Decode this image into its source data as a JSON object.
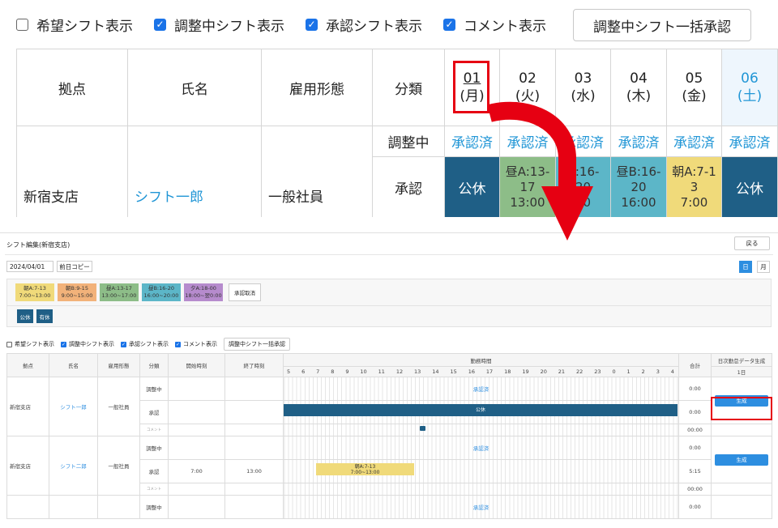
{
  "zoom": {
    "options": [
      {
        "label": "希望シフト表示",
        "checked": false
      },
      {
        "label": "調整中シフト表示",
        "checked": true
      },
      {
        "label": "承認シフト表示",
        "checked": true
      },
      {
        "label": "コメント表示",
        "checked": true
      }
    ],
    "bulk_approve_label": "調整中シフト一括承認",
    "headers": {
      "location": "拠点",
      "name": "氏名",
      "employment": "雇用形態",
      "category": "分類"
    },
    "days": [
      {
        "num": "01",
        "dow": "(月)"
      },
      {
        "num": "02",
        "dow": "(火)"
      },
      {
        "num": "03",
        "dow": "(水)"
      },
      {
        "num": "04",
        "dow": "(木)"
      },
      {
        "num": "05",
        "dow": "(金)"
      },
      {
        "num": "06",
        "dow": "(土)"
      }
    ],
    "row": {
      "location": "新宿支店",
      "name": "シフト一郎",
      "employment": "一般社員",
      "adjusting_label": "調整中",
      "approved_label": "承認",
      "adjusting_status": "承認済",
      "cells": [
        {
          "l1": "公休",
          "l2": "",
          "l3": ""
        },
        {
          "l1": "昼A:13-",
          "l2": "17",
          "l3": "13:00"
        },
        {
          "l1": "B:16-",
          "l2": "20",
          "l3": "00"
        },
        {
          "l1": "昼B:16-",
          "l2": "20",
          "l3": "16:00"
        },
        {
          "l1": "朝A:7-1",
          "l2": "3",
          "l3": "7:00"
        },
        {
          "l1": "公休",
          "l2": "",
          "l3": ""
        }
      ]
    }
  },
  "editor": {
    "title": "シフト編集(新宿支店)",
    "back_label": "戻る",
    "date_value": "2024/04/01",
    "copy_label": "前日コピー",
    "view_day": "日",
    "view_month": "月",
    "patterns": [
      {
        "name": "朝A:7-13",
        "time": "7:00~13:00",
        "color": "#f0da7a"
      },
      {
        "name": "朝B:9-15",
        "time": "9:00~15:00",
        "color": "#f2b27a"
      },
      {
        "name": "昼A:13-17",
        "time": "13:00~17:00",
        "color": "#8dbd88"
      },
      {
        "name": "昼B:16-20",
        "time": "16:00~20:00",
        "color": "#5cb6c8"
      },
      {
        "name": "夕A:18-00",
        "time": "18:00~翌0:00",
        "color": "#b68bcd"
      }
    ],
    "cancel_label": "承認取消",
    "holiday1": "公休",
    "holiday2": "有休",
    "options": [
      {
        "label": "希望シフト表示",
        "checked": false
      },
      {
        "label": "調整中シフト表示",
        "checked": true
      },
      {
        "label": "承認シフト表示",
        "checked": true
      },
      {
        "label": "コメント表示",
        "checked": true
      }
    ],
    "bulk_label": "調整中シフト一括承認",
    "headers": {
      "location": "拠点",
      "name": "氏名",
      "employment": "雇用形態",
      "category": "分類",
      "start": "開始時刻",
      "end": "終了時刻",
      "work_hours": "勤務時間",
      "total": "合計",
      "daily": "日次勤怠データ生成",
      "daily_sub": "1日"
    },
    "hours": [
      "5",
      "6",
      "7",
      "8",
      "9",
      "10",
      "11",
      "12",
      "13",
      "14",
      "15",
      "16",
      "17",
      "18",
      "19",
      "20",
      "21",
      "22",
      "23",
      "0",
      "1",
      "2",
      "3",
      "4"
    ],
    "status_approved": "承認済",
    "gen_label": "生成",
    "cat_adjusting": "調整中",
    "cat_approved": "承認",
    "cat_comment": "コメント",
    "employees": [
      {
        "location": "新宿支店",
        "name": "シフト一郎",
        "employment": "一般社員",
        "start": "",
        "end": "",
        "adj_total": "0:00",
        "app_total": "0:00",
        "cmt_total": "00:00",
        "bar_name": "公休",
        "bar_time": ""
      },
      {
        "location": "新宿支店",
        "name": "シフト二郎",
        "employment": "一般社員",
        "start": "7:00",
        "end": "13:00",
        "adj_total": "0:00",
        "app_total": "5:15",
        "cmt_total": "00:00",
        "bar_name": "朝A:7-13",
        "bar_time": "7:00~13:00"
      }
    ],
    "third_adj_label": "調整中",
    "third_total": "0:00"
  }
}
